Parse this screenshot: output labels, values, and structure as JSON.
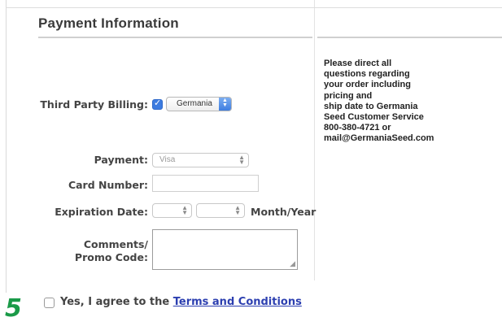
{
  "section": {
    "title": "Payment Information"
  },
  "help": {
    "lines": [
      "Please direct all",
      "questions regarding",
      "your order including",
      "pricing and",
      "ship date to Germania",
      "Seed Customer Service",
      "800-380-4721 or",
      "mail@GermaniaSeed.com"
    ]
  },
  "form": {
    "third_party_billing": {
      "label": "Third Party Billing:",
      "checked": true,
      "selected": "Germania"
    },
    "payment": {
      "label": "Payment:",
      "selected": "Visa"
    },
    "card_number": {
      "label": "Card Number:",
      "value": ""
    },
    "expiration": {
      "label": "Expiration Date:",
      "month": "",
      "year": "",
      "suffix": "Month/Year"
    },
    "comments": {
      "label_line1": "Comments/",
      "label_line2": "Promo Code:",
      "value": ""
    }
  },
  "agreement": {
    "prefix": "Yes, I agree to the ",
    "link_text": "Terms and Conditions",
    "checked": false
  },
  "step": {
    "number": "5"
  },
  "colors": {
    "step_green": "#1a9a48",
    "link_blue": "#2c3fb0",
    "checkbox_blue": "#3c7be0"
  }
}
